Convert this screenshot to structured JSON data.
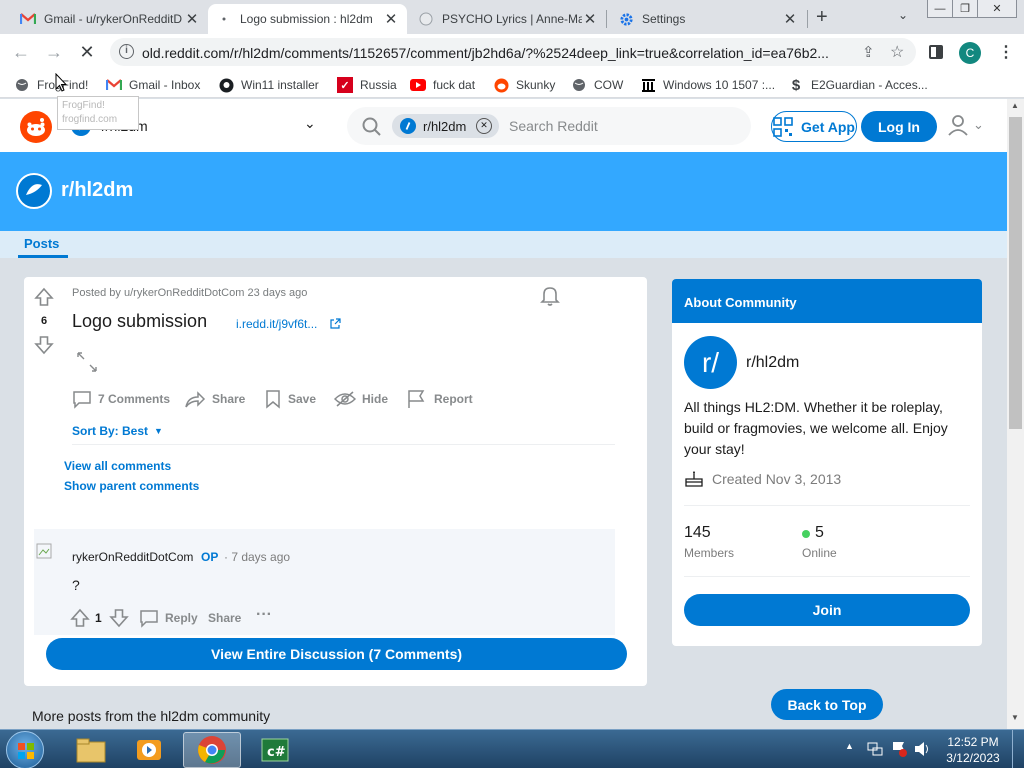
{
  "browser": {
    "tabs": [
      {
        "title": "Gmail - u/rykerOnRedditD",
        "icon": "gmail-icon",
        "active": false
      },
      {
        "title": "Logo submission : hl2dm",
        "icon": "loading-icon",
        "active": true
      },
      {
        "title": "PSYCHO Lyrics | Anne-Ma",
        "icon": "globe-icon",
        "active": false
      },
      {
        "title": "Settings",
        "icon": "settings-gear-icon",
        "active": false
      }
    ],
    "url": "old.reddit.com/r/hl2dm/comments/1152657/comment/jb2hd6a/?%2524deep_link=true&correlation_id=ea76b2...",
    "profile_initial": "C",
    "bookmarks": [
      {
        "label": "FrogFind!",
        "icon": "globe-icon"
      },
      {
        "label": "Gmail - Inbox",
        "icon": "gmail-icon"
      },
      {
        "label": "Win11 installer",
        "icon": "github-icon"
      },
      {
        "label": "Russia",
        "icon": "flag-icon"
      },
      {
        "label": "fuck dat",
        "icon": "youtube-icon"
      },
      {
        "label": "Skunky",
        "icon": "reddit-icon"
      },
      {
        "label": "COW",
        "icon": "globe-icon"
      },
      {
        "label": "Windows 10 1507 :...",
        "icon": "archive-icon"
      },
      {
        "label": "E2Guardian - Acces...",
        "icon": "dollar-icon"
      }
    ],
    "tooltip": {
      "line1": "FrogFind!",
      "line2": "frogfind.com"
    }
  },
  "reddit": {
    "header": {
      "community": "r/hl2dm",
      "search_chip": "r/hl2dm",
      "search_placeholder": "Search Reddit",
      "get_app": "Get App",
      "login": "Log In"
    },
    "banner": {
      "title": "r/hl2dm"
    },
    "subnav": {
      "tab": "Posts"
    },
    "post": {
      "score": "6",
      "posted_by": "Posted by u/rykerOnRedditDotCom 23 days ago",
      "title": "Logo submission",
      "link": "i.redd.it/j9vf6t...",
      "actions": {
        "comments": "7 Comments",
        "share": "Share",
        "save": "Save",
        "hide": "Hide",
        "report": "Report"
      },
      "sort_by": "Sort By: Best",
      "view_all_comments": "View all comments",
      "show_parent_comments": "Show parent comments",
      "comment": {
        "author": "rykerOnRedditDotCom",
        "op": "OP",
        "time": "· 7 days ago",
        "body": "?",
        "score": "1",
        "reply": "Reply",
        "share": "Share",
        "more": "···"
      },
      "view_entire": "View Entire Discussion (7 Comments)",
      "more_posts": "More posts from the hl2dm community"
    },
    "sidebar": {
      "heading": "About Community",
      "avatar_text": "r/",
      "name": "r/hl2dm",
      "description": "All things HL2:DM. Whether it be roleplay, build or fragmovies, we welcome all. Enjoy your stay!",
      "created": "Created Nov 3, 2013",
      "members_count": "145",
      "members_label": "Members",
      "online_count": "5",
      "online_label": "Online",
      "join": "Join"
    },
    "back_to_top": "Back to Top"
  },
  "taskbar": {
    "time": "12:52 PM",
    "date": "3/12/2023",
    "apps": [
      "start-orb-icon",
      "file-explorer-icon",
      "media-player-icon",
      "chrome-icon",
      "csharp-icon"
    ]
  },
  "colors": {
    "reddit_blue": "#0079d3",
    "banner_blue": "#33a8ff",
    "reddit_orange": "#ff4500",
    "online_green": "#46d160"
  }
}
